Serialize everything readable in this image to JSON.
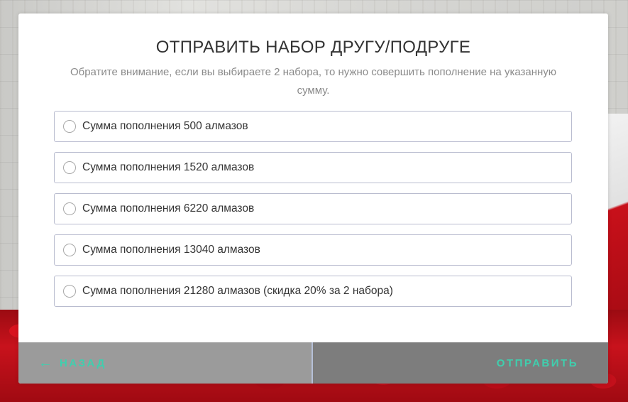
{
  "modal": {
    "title": "ОТПРАВИТЬ НАБОР ДРУГУ/ПОДРУГЕ",
    "subtitle": "Обратите внимание, если вы выбираете 2 набора, то нужно совершить пополнение на указанную сумму."
  },
  "options": [
    {
      "label": "Сумма пополнения 500 алмазов",
      "selected": false
    },
    {
      "label": "Сумма пополнения 1520 алмазов",
      "selected": false
    },
    {
      "label": "Сумма пополнения 6220 алмазов",
      "selected": false
    },
    {
      "label": "Сумма пополнения 13040 алмазов",
      "selected": false
    },
    {
      "label": "Сумма пополнения 21280 алмазов (скидка 20% за 2 набора)",
      "selected": false
    }
  ],
  "footer": {
    "back_label": "НАЗАД",
    "back_icon": "arrow-left-icon",
    "submit_label": "ОТПРАВИТЬ"
  },
  "colors": {
    "accent": "#3fcfae",
    "back_bg": "#9b9b9b",
    "submit_bg": "#7d7d7d",
    "option_border": "#b9bccf"
  }
}
